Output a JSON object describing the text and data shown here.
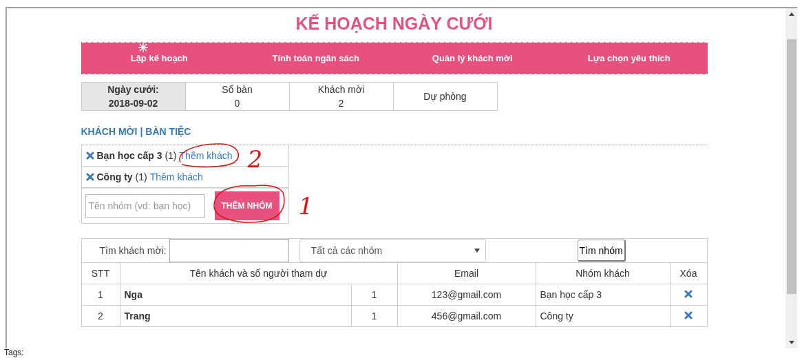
{
  "title": "KẾ HOẠCH NGÀY CƯỚI",
  "nav": [
    "Lập kế hoạch",
    "Tính toán ngân sách",
    "Quản lý khách mời",
    "Lựa chọn yêu thích"
  ],
  "stats": [
    {
      "label": "Ngày cưới:",
      "value": "2018-09-02",
      "kind": "date"
    },
    {
      "label": "Số bàn",
      "value": "0",
      "kind": "count"
    },
    {
      "label": "Khách mời",
      "value": "2",
      "kind": "count"
    },
    {
      "label": "Dự phòng",
      "kind": "count"
    }
  ],
  "sections": [
    "KHÁCH MỜI",
    "BÀN TIỆC"
  ],
  "separator": "|",
  "groups": [
    {
      "name": "Bạn học cấp 3",
      "count": "(1)",
      "link": "Thêm khách"
    },
    {
      "name": "Công ty",
      "count": "(1)",
      "link": "Thêm khách"
    }
  ],
  "group_form": {
    "placeholder": "Tên nhóm (vd: bạn học)",
    "button": "THÊM NHÓM"
  },
  "search": {
    "label": "Tìm khách mời:",
    "select": "Tất cả các nhóm",
    "button": "Tìm nhóm"
  },
  "table": {
    "columns": [
      "STT",
      "Tên khách và số người tham dự",
      "Email",
      "Nhóm khách",
      "Xóa"
    ],
    "rows": [
      {
        "no": "1",
        "name": "Nga",
        "people": "1",
        "email": "123@gmail.com",
        "group": "Bạn học cấp 3"
      },
      {
        "no": "2",
        "name": "Trang",
        "people": "1",
        "email": "456@gmail.com",
        "group": "Công ty"
      }
    ]
  },
  "annotations": [
    "2",
    "1"
  ],
  "footer": "Tags:"
}
